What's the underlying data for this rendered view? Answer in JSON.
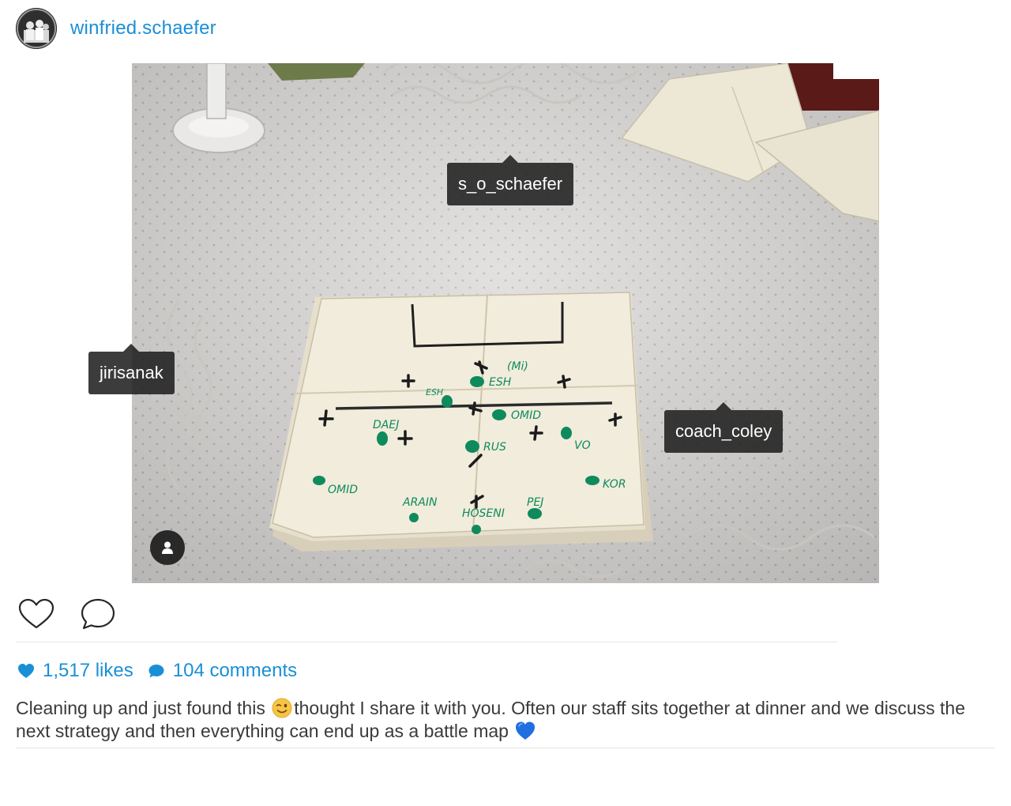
{
  "post": {
    "username": "winfried.schaefer",
    "tags": [
      {
        "label": "s_o_schaefer"
      },
      {
        "label": "jirisanak"
      },
      {
        "label": "coach_coley"
      }
    ],
    "stats": {
      "likes_label": "1,517 likes",
      "comments_label": "104 comments"
    },
    "caption": {
      "part1": "Cleaning up and just found this ",
      "emoji1": "winking-face-emoji",
      "part2": "thought I share it with you. Often our staff sits together at dinner and we discuss the next strategy and then everything can end up as a battle map ",
      "emoji2": "blue-heart-emoji"
    },
    "sketch_labels": [
      "(Mi)",
      "ESH",
      "ESH",
      "OMID",
      "DAEJ",
      "RUS",
      "VO",
      "OMID",
      "KOR",
      "ARAIN",
      "HOSENI",
      "PEJ"
    ],
    "icons": {
      "like": "heart-outline-icon",
      "comment": "speech-bubble-icon",
      "likes_stat": "heart-filled-icon",
      "comments_stat": "comment-filled-icon",
      "user_tags": "person-icon"
    },
    "colors": {
      "link": "#1a8fd6",
      "marker_green": "#0f8a5c",
      "tag_bg": "#1c1c1c"
    }
  }
}
